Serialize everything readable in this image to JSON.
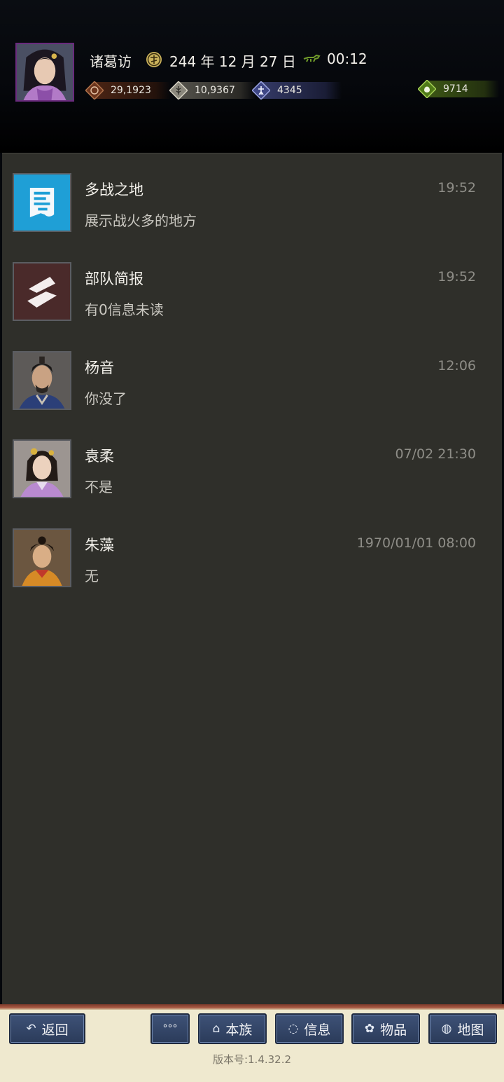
{
  "header": {
    "player_name": "诸葛访",
    "date": "244 年 12 月 27 日",
    "time": "00:12",
    "resources": [
      {
        "name": "money",
        "icon": "coin-icon",
        "value": "29,1923",
        "color": "#7a3f22"
      },
      {
        "name": "food",
        "icon": "grain-icon",
        "value": "10,9367",
        "color": "#6f6c62"
      },
      {
        "name": "soldiers",
        "icon": "soldier-icon",
        "value": "4345",
        "color": "#3d4478"
      },
      {
        "name": "treasure",
        "icon": "bag-icon",
        "value": "9714",
        "color": "#4c6a1c"
      }
    ]
  },
  "messages": [
    {
      "title": "多战之地",
      "subtitle": "展示战火多的地方",
      "time": "19:52",
      "avatar": "war-map-icon"
    },
    {
      "title": "部队简报",
      "subtitle": "有0信息未读",
      "time": "19:52",
      "avatar": "army-report-icon"
    },
    {
      "title": "杨音",
      "subtitle": "你没了",
      "time": "12:06",
      "avatar": "male-general-portrait"
    },
    {
      "title": "袁柔",
      "subtitle": "不是",
      "time": "07/02 21:30",
      "avatar": "female-portrait"
    },
    {
      "title": "朱藻",
      "subtitle": "无",
      "time": "1970/01/01 08:00",
      "avatar": "child-portrait"
    }
  ],
  "footer": {
    "back_label": "返回",
    "more_label": "°°°",
    "clan_label": "本族",
    "info_label": "信息",
    "items_label": "物品",
    "map_label": "地图",
    "version": "版本号:1.4.32.2"
  }
}
